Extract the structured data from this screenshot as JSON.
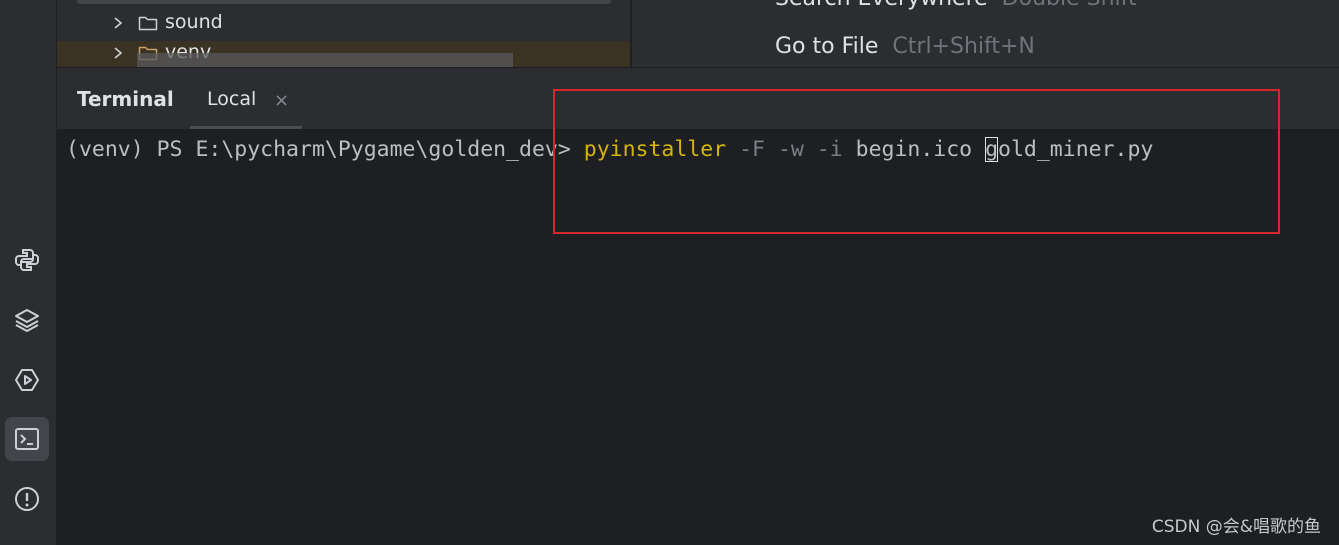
{
  "project_tree": {
    "rows": [
      {
        "name": "sound",
        "type": "folder"
      },
      {
        "name": "venv",
        "type": "folder"
      }
    ]
  },
  "welcome_hints": [
    {
      "action": "Search Everywhere",
      "shortcut": "Double Shift"
    },
    {
      "action": "Go to File",
      "shortcut": "Ctrl+Shift+N"
    }
  ],
  "terminal": {
    "title": "Terminal",
    "tab_label": "Local",
    "tab_close": "×",
    "prompt": "(venv) PS E:\\pycharm\\Pygame\\golden_dev> ",
    "exe": "pyinstaller",
    "flags": "-F -w -i",
    "arg_ico": "begin.ico",
    "caret_char": "g",
    "arg_rest": "old_miner.py"
  },
  "tool_strip": {
    "icons": [
      "python-console-icon",
      "layers-icon",
      "services-icon",
      "terminal-icon",
      "problems-icon"
    ],
    "active": "terminal-icon"
  },
  "colors": {
    "annotation": "#d9262d",
    "command_exe": "#d5b40a"
  },
  "watermark": "CSDN @会&唱歌的鱼"
}
